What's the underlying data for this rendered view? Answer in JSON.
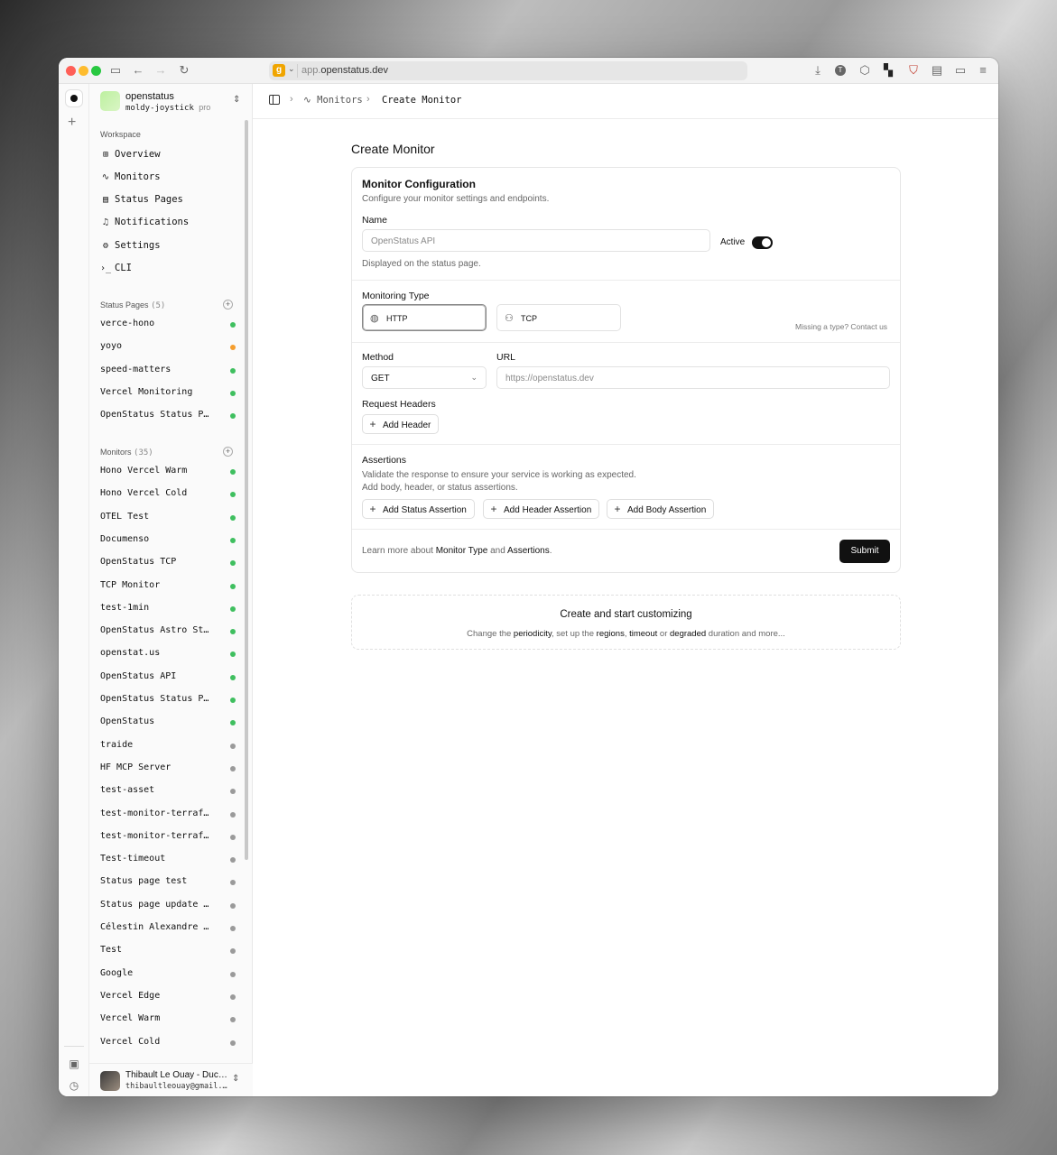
{
  "browser": {
    "url_domain_dim": "app.",
    "url_domain": "openstatus.dev",
    "site_icon_letter": "g"
  },
  "workspace": {
    "name": "openstatus",
    "slug": "moldy-joystick",
    "plan": "pro"
  },
  "sidebar": {
    "section_workspace": "Workspace",
    "nav": [
      {
        "label": "Overview",
        "icon": "grid-icon"
      },
      {
        "label": "Monitors",
        "icon": "activity-icon"
      },
      {
        "label": "Status Pages",
        "icon": "panel-icon"
      },
      {
        "label": "Notifications",
        "icon": "bell-icon"
      },
      {
        "label": "Settings",
        "icon": "gear-icon"
      },
      {
        "label": "CLI",
        "icon": "terminal-icon"
      }
    ],
    "status_pages_label": "Status Pages",
    "status_pages_count": "(5)",
    "status_pages": [
      {
        "name": "verce-hono",
        "status": "green"
      },
      {
        "name": "yoyo",
        "status": "orange"
      },
      {
        "name": "speed-matters",
        "status": "green"
      },
      {
        "name": "Vercel Monitoring",
        "status": "green"
      },
      {
        "name": "OpenStatus Status Page",
        "status": "green"
      }
    ],
    "monitors_label": "Monitors",
    "monitors_count": "(35)",
    "monitors": [
      {
        "name": "Hono Vercel Warm",
        "status": "green"
      },
      {
        "name": "Hono Vercel Cold",
        "status": "green"
      },
      {
        "name": "OTEL Test",
        "status": "green"
      },
      {
        "name": "Documenso",
        "status": "green"
      },
      {
        "name": "OpenStatus TCP",
        "status": "green"
      },
      {
        "name": "TCP Monitor",
        "status": "green"
      },
      {
        "name": "test-1min",
        "status": "green"
      },
      {
        "name": "OpenStatus Astro Status",
        "status": "green"
      },
      {
        "name": "openstat.us",
        "status": "green"
      },
      {
        "name": "OpenStatus API",
        "status": "green"
      },
      {
        "name": "OpenStatus Status Page",
        "status": "green"
      },
      {
        "name": "OpenStatus",
        "status": "green"
      },
      {
        "name": "traide",
        "status": "gray"
      },
      {
        "name": "HF MCP Server",
        "status": "gray"
      },
      {
        "name": "test-asset",
        "status": "gray"
      },
      {
        "name": "test-monitor-terraform",
        "status": "gray"
      },
      {
        "name": "test-monitor-terraform",
        "status": "gray"
      },
      {
        "name": "Test-timeout",
        "status": "gray"
      },
      {
        "name": "Status page test",
        "status": "gray"
      },
      {
        "name": "Status page update test",
        "status": "gray"
      },
      {
        "name": "Célestin Alexandre test",
        "status": "gray"
      },
      {
        "name": "Test",
        "status": "gray"
      },
      {
        "name": "Google",
        "status": "gray"
      },
      {
        "name": "Vercel Edge",
        "status": "gray"
      },
      {
        "name": "Vercel Warm",
        "status": "gray"
      },
      {
        "name": "Vercel Cold",
        "status": "gray"
      }
    ]
  },
  "user": {
    "name": "Thibault Le Ouay - Ducasse",
    "email": "thibaultleouay@gmail.com"
  },
  "breadcrumb": {
    "parent": "Monitors",
    "current": "Create Monitor"
  },
  "page": {
    "title": "Create Monitor"
  },
  "form": {
    "title": "Monitor Configuration",
    "description": "Configure your monitor settings and endpoints.",
    "name_label": "Name",
    "name_placeholder": "OpenStatus API",
    "active_label": "Active",
    "active": true,
    "name_hint": "Displayed on the status page.",
    "type_label": "Monitoring Type",
    "types": [
      "HTTP",
      "TCP"
    ],
    "selected_type": "HTTP",
    "missing_type": "Missing a type? Contact us",
    "method_label": "Method",
    "method_value": "GET",
    "url_label": "URL",
    "url_placeholder": "https://openstatus.dev",
    "headers_label": "Request Headers",
    "add_header": "Add Header",
    "assertions_label": "Assertions",
    "assertions_desc_1": "Validate the response to ensure your service is working as expected.",
    "assertions_desc_2": "Add body, header, or status assertions.",
    "add_status_assertion": "Add Status Assertion",
    "add_header_assertion": "Add Header Assertion",
    "add_body_assertion": "Add Body Assertion",
    "learn_prefix": "Learn more about ",
    "learn_link_1": "Monitor Type",
    "learn_and": " and ",
    "learn_link_2": "Assertions",
    "learn_suffix": ".",
    "submit": "Submit"
  },
  "customize": {
    "title": "Create and start customizing",
    "p1": "Change the ",
    "l1": "periodicity",
    "p2": ", set up the ",
    "l2": "regions",
    "p3": ", ",
    "l3": "timeout",
    "p4": " or ",
    "l4": "degraded",
    "p5": " duration and more..."
  }
}
